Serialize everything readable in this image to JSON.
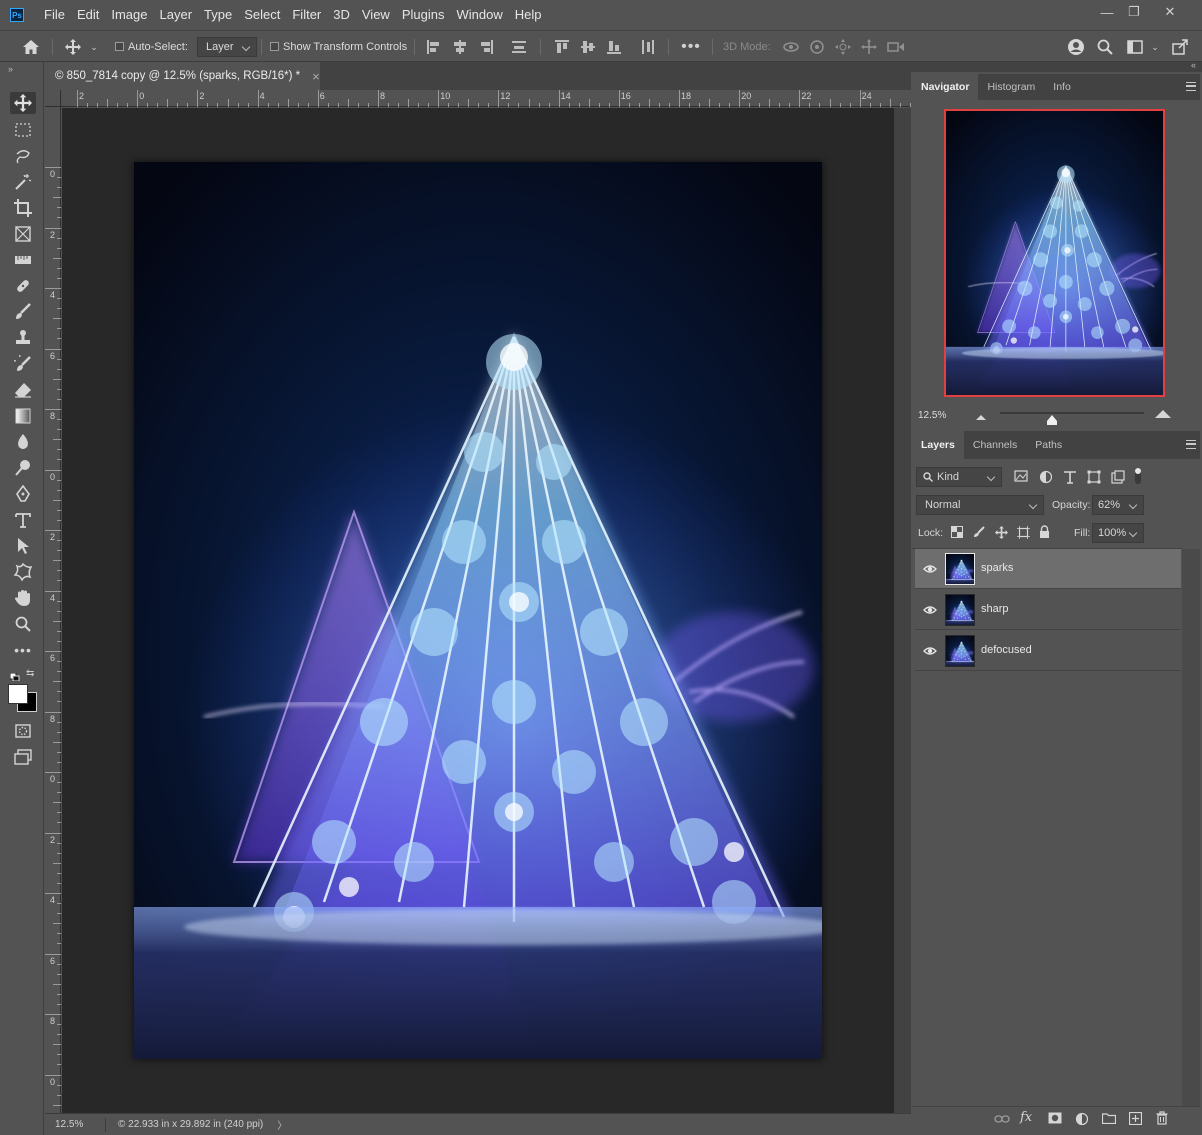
{
  "app": {
    "logo_text": "Ps"
  },
  "menu": [
    "File",
    "Edit",
    "Image",
    "Layer",
    "Type",
    "Select",
    "Filter",
    "3D",
    "View",
    "Plugins",
    "Window",
    "Help"
  ],
  "window_controls": {
    "minimize": "—",
    "restore": "❐",
    "close": "✕"
  },
  "options_bar": {
    "auto_select_label": "Auto-Select:",
    "auto_select_target": "Layer",
    "show_transform_controls_label": "Show Transform Controls",
    "three_d_mode_label": "3D Mode:"
  },
  "document": {
    "tab_title": "© 850_7814 copy @ 12.5% (sparks, RGB/16*) *",
    "close_glyph": "×",
    "ruler_top_labels": [
      "2",
      "0",
      "2",
      "4",
      "6",
      "8",
      "10",
      "12",
      "14",
      "16",
      "18",
      "20",
      "22",
      "24"
    ],
    "ruler_left_labels": [
      "0",
      "2",
      "4",
      "6",
      "8",
      "0",
      "2",
      "4",
      "6",
      "8",
      "0",
      "2",
      "4",
      "6",
      "8",
      "0"
    ]
  },
  "status": {
    "zoom": "12.5%",
    "doc_info": "© 22.933 in x 29.892 in (240 ppi)",
    "arrow": "〉"
  },
  "navigator_panel": {
    "tabs": [
      "Navigator",
      "Histogram",
      "Info"
    ],
    "active_tab": "Navigator",
    "zoom": "12.5%"
  },
  "layers_panel": {
    "tabs": [
      "Layers",
      "Channels",
      "Paths"
    ],
    "active_tab": "Layers",
    "filter_kind": "Kind",
    "blend_mode": "Normal",
    "opacity_label": "Opacity:",
    "opacity_value": "62%",
    "lock_label": "Lock:",
    "fill_label": "Fill:",
    "fill_value": "100%",
    "layers": [
      {
        "name": "sparks",
        "selected": true
      },
      {
        "name": "sharp",
        "selected": false
      },
      {
        "name": "defocused",
        "selected": false
      }
    ]
  },
  "colors": {
    "ui_bg": "#535353",
    "ui_dark": "#424242",
    "canvas_bg": "#282828",
    "accent_red": "#e04040",
    "brand_blue": "#31a8ff"
  }
}
